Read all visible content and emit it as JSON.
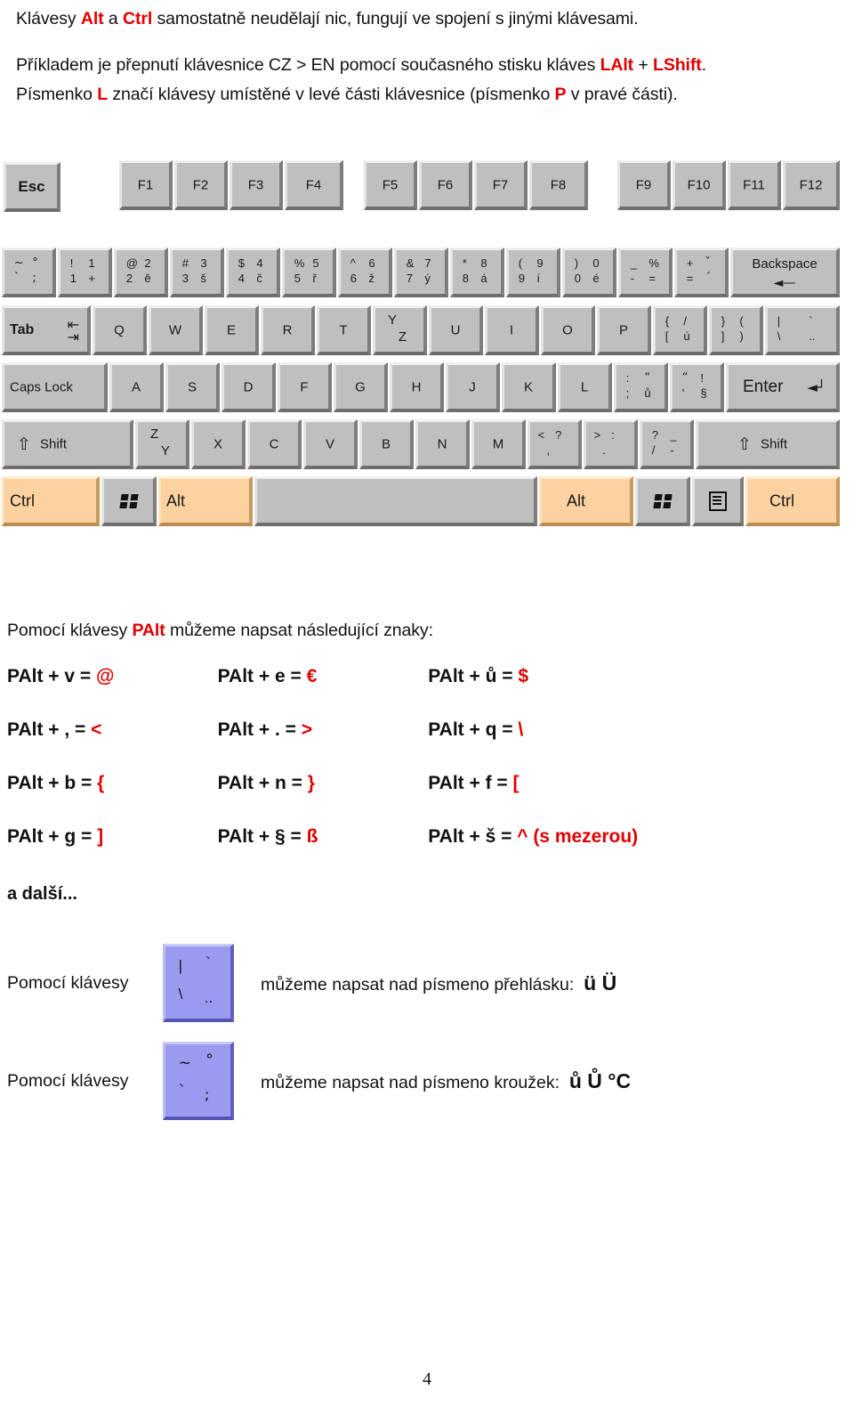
{
  "intro": {
    "line1_a": "Klávesy ",
    "line1_alt": "Alt",
    "line1_b": " a ",
    "line1_ctrl": "Ctrl",
    "line1_c": " samostatně neudělají nic, fungují ve spojení s jinými klávesami.",
    "line2_a": "Příkladem je přepnutí klávesnice CZ > EN pomocí současného stisku kláves ",
    "line2_lalt": "LAlt",
    "line2_b": " + ",
    "line2_lshift": "LShift",
    "line2_c": ".",
    "line3_a": "Písmenko ",
    "line3_l": "L",
    "line3_b": " značí klávesy umístěné v levé části klávesnice (písmenko ",
    "line3_p": "P",
    "line3_c": " v pravé části)."
  },
  "colors": {
    "accent_red": "#e00000",
    "key_face": "#bfbfbf",
    "key_highlight": "#fbd2a0",
    "blue_key": "#9a9aee"
  },
  "keyboard": {
    "function_row": {
      "esc": "Esc",
      "f_keys_1": [
        "F1",
        "F2",
        "F3",
        "F4"
      ],
      "f_keys_2": [
        "F5",
        "F6",
        "F7",
        "F8"
      ],
      "f_keys_3": [
        "F9",
        "F10",
        "F11",
        "F12"
      ]
    },
    "number_row": [
      {
        "tl": "~",
        "tr": "°",
        "bl": "`",
        "br": ";"
      },
      {
        "tl": "!",
        "tr": "1",
        "bl": "1",
        "br": "+"
      },
      {
        "tl": "@",
        "tr": "2",
        "bl": "2",
        "br": "ě"
      },
      {
        "tl": "#",
        "tr": "3",
        "bl": "3",
        "br": "š"
      },
      {
        "tl": "$",
        "tr": "4",
        "bl": "4",
        "br": "č"
      },
      {
        "tl": "%",
        "tr": "5",
        "bl": "5",
        "br": "ř"
      },
      {
        "tl": "^",
        "tr": "6",
        "bl": "6",
        "br": "ž"
      },
      {
        "tl": "&",
        "tr": "7",
        "bl": "7",
        "br": "ý"
      },
      {
        "tl": "*",
        "tr": "8",
        "bl": "8",
        "br": "á"
      },
      {
        "tl": "(",
        "tr": "9",
        "bl": "9",
        "br": "í"
      },
      {
        "tl": ")",
        "tr": "0",
        "bl": "0",
        "br": "é"
      },
      {
        "tl": "_",
        "tr": "%",
        "bl": "-",
        "br": "="
      },
      {
        "tl": "+",
        "tr": "ˇ",
        "bl": "=",
        "br": "´"
      }
    ],
    "backspace": {
      "label": "Backspace",
      "arrow": "◄—"
    },
    "qwerty_row": {
      "tab": "Tab",
      "letters": [
        "Q",
        "W",
        "E",
        "R",
        "T"
      ],
      "yz": {
        "up": "Y",
        "dn": "Z"
      },
      "letters2": [
        "U",
        "I",
        "O",
        "P"
      ],
      "punct": [
        {
          "tl": "{",
          "tr": "/",
          "bl": "[",
          "br": "ú"
        },
        {
          "tl": "}",
          "tr": "(",
          "bl": "]",
          "br": ")"
        },
        {
          "tl": "|",
          "tr": "`",
          "bl": "\\",
          "br": ".."
        }
      ]
    },
    "home_row": {
      "caps_lock": "Caps Lock",
      "letters": [
        "A",
        "S",
        "D",
        "F",
        "G",
        "H",
        "J",
        "K",
        "L"
      ],
      "punct": [
        {
          "tl": ":",
          "tr": "“",
          "bl": ";",
          "br": "ů"
        },
        {
          "tl": "“",
          "tr": "!",
          "bl": "'",
          "br": "§"
        }
      ],
      "enter": "Enter",
      "enter_arrow": "◄┘"
    },
    "shift_row": {
      "shift_left": "Shift",
      "shift_right": "Shift",
      "shift_arrow": "⇧",
      "zy": {
        "up": "Z",
        "dn": "Y"
      },
      "letters": [
        "X",
        "C",
        "V",
        "B",
        "N",
        "M"
      ],
      "punct": [
        {
          "tl": "<",
          "tr": "?",
          "bl": ",",
          "br": ""
        },
        {
          "tl": ">",
          "tr": ":",
          "bl": ".",
          "br": ""
        },
        {
          "tl": "?",
          "tr": "_",
          "bl": "/",
          "br": "-"
        }
      ]
    },
    "bottom_row": {
      "ctrl_left": "Ctrl",
      "win_left": "windows-key",
      "alt_left": "Alt",
      "space": "",
      "alt_right": "Alt",
      "win_right": "windows-key",
      "menu": "context-menu-key",
      "ctrl_right": "Ctrl"
    }
  },
  "palt": {
    "intro_a": "Pomocí klávesy ",
    "intro_key": "PAlt",
    "intro_b": " můžeme napsat následující znaky:",
    "rows": [
      [
        {
          "combo": "PAlt + v = ",
          "result": "@"
        },
        {
          "combo": "PAlt + e = ",
          "result": "€"
        },
        {
          "combo": "PAlt + ů = ",
          "result": "$"
        }
      ],
      [
        {
          "combo": "PAlt + , = ",
          "result": "<"
        },
        {
          "combo": "PAlt + . = ",
          "result": ">"
        },
        {
          "combo": "PAlt + q = ",
          "result": "\\"
        }
      ],
      [
        {
          "combo": "PAlt + b = ",
          "result": "{"
        },
        {
          "combo": "PAlt + n = ",
          "result": "}"
        },
        {
          "combo": "PAlt + f = ",
          "result": "["
        }
      ],
      [
        {
          "combo": "PAlt + g = ",
          "result": "]"
        },
        {
          "combo": "PAlt + § = ",
          "result": "ß"
        },
        {
          "combo": "PAlt + š = ",
          "result": "^ (s mezerou)"
        }
      ]
    ],
    "further": "a další..."
  },
  "callouts": [
    {
      "pre": "Pomocí klávesy",
      "key": {
        "tl": "|",
        "tr": "`",
        "bl": "\\",
        "br": ".."
      },
      "post": "můžeme napsat nad písmeno přehlásku:",
      "examples": "ü Ü"
    },
    {
      "pre": "Pomocí klávesy",
      "key": {
        "tl": "~",
        "tr": "°",
        "bl": "`",
        "br": ";"
      },
      "post": "můžeme napsat nad písmeno kroužek:",
      "examples": "ů Ů °C"
    }
  ],
  "page_number": "4"
}
